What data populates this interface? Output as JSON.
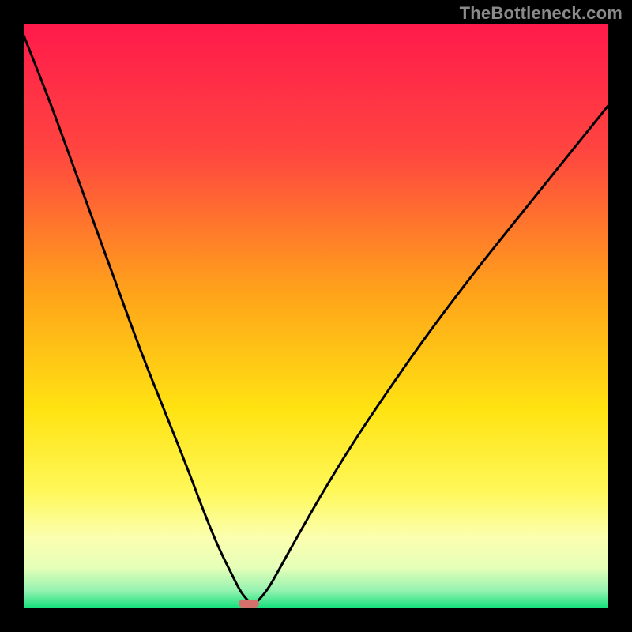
{
  "watermark": {
    "text": "TheBottleneck.com"
  },
  "chart_data": {
    "type": "line",
    "title": "",
    "xlabel": "",
    "ylabel": "",
    "xlim": [
      0,
      100
    ],
    "ylim": [
      0,
      100
    ],
    "grid": false,
    "legend": false,
    "annotations": [],
    "gradient_stops": [
      {
        "pct": 0,
        "color": "#ff1a4b"
      },
      {
        "pct": 22,
        "color": "#ff4640"
      },
      {
        "pct": 46,
        "color": "#ffa31a"
      },
      {
        "pct": 66,
        "color": "#ffe312"
      },
      {
        "pct": 80,
        "color": "#fff85a"
      },
      {
        "pct": 88,
        "color": "#fbffb0"
      },
      {
        "pct": 93,
        "color": "#e6ffb8"
      },
      {
        "pct": 97,
        "color": "#94f2b0"
      },
      {
        "pct": 100,
        "color": "#12e07a"
      }
    ],
    "min_marker": {
      "x": 38.5,
      "y": 99.2,
      "width": 3.6,
      "height": 1.4,
      "color": "#d4716d"
    },
    "series": [
      {
        "name": "bottleneck-curve",
        "x": [
          0,
          4,
          8,
          12,
          16,
          20,
          24,
          28,
          31,
          33.5,
          35.5,
          37,
          38,
          38.8,
          39.6,
          40.5,
          42,
          44,
          47,
          51,
          56,
          62,
          69,
          77,
          86,
          95,
          100
        ],
        "y": [
          2,
          12,
          23,
          34,
          45,
          56,
          66,
          76,
          84,
          90,
          94,
          97,
          98.3,
          99.1,
          99.1,
          98.3,
          96.4,
          92.8,
          87.4,
          80.4,
          72.2,
          63.2,
          53.2,
          42.6,
          31.4,
          20.2,
          14
        ]
      }
    ]
  }
}
